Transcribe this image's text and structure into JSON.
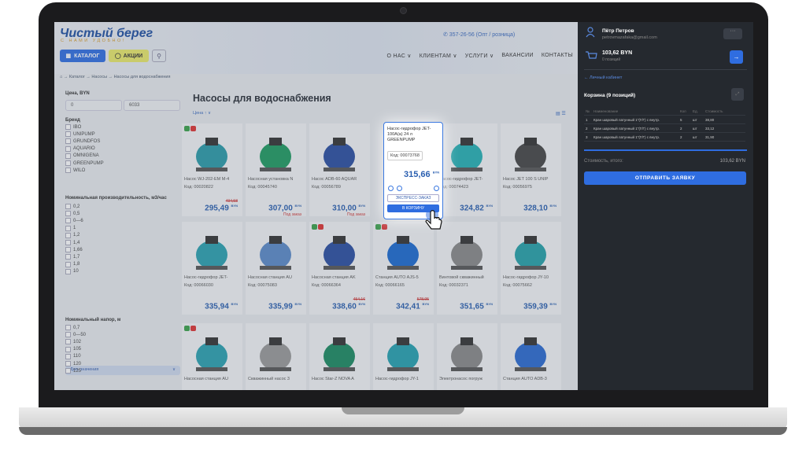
{
  "header": {
    "logo": "Чистый берег",
    "slogan": "С НАМИ УДОБНО!",
    "phone": "✆ 357-26-56 (Опт / розница)",
    "catalog_label": "КАТАЛОГ",
    "promo_label": "АКЦИИ",
    "nav": [
      "О НАС ∨",
      "КЛИЕНТАМ ∨",
      "УСЛУГИ ∨",
      "ВАКАНСИИ",
      "КОНТАКТЫ"
    ]
  },
  "breadcrumb": "⌂ → Каталог → Насосы → Насосы для водоснабжения",
  "filters": {
    "price_label": "Цена, BYN",
    "price_min": "0",
    "price_max": "6033",
    "brand_label": "Бренд",
    "brands": [
      "IBO",
      "UNIPUMP",
      "GRUNDFOS",
      "AQUARIO",
      "OMNIGENA",
      "GREENPUMP",
      "WILO"
    ],
    "perf_label": "Номинальная производительность, м3/час",
    "perf": [
      "0,2",
      "0,5",
      "0—6",
      "1",
      "1,2",
      "1,4",
      "1,66",
      "1,7",
      "1,8",
      "10"
    ],
    "more_label": "Доп. значения",
    "head_label": "Номинальный напор, м",
    "head": [
      "0,7",
      "0—50",
      "102",
      "105",
      "110",
      "120",
      "125"
    ]
  },
  "page_title": "Насосы для водоснабжения",
  "sort_label": "Цена ↑   ∨",
  "products": [
    {
      "name": "Насос WJ-202-EM M-4",
      "code": "Код: 00020822",
      "old": "494,58",
      "price": "295,49",
      "note": "",
      "badges": true
    },
    {
      "name": "Насосная установка N",
      "code": "Код: 00045740",
      "old": "",
      "price": "307,00",
      "note": "Под заказ",
      "badges": false
    },
    {
      "name": "Насос ADB-60 AQUAR",
      "code": "Код: 00056789",
      "old": "",
      "price": "310,00",
      "note": "Под заказ",
      "badges": false
    },
    {
      "name": "Насос-гидрофор JET-",
      "code": "Код: 00074423",
      "old": "",
      "price": "324,82",
      "note": "",
      "badges": false
    },
    {
      "name": "Насос JET 100 S UNIP",
      "code": "Код: 00056975",
      "old": "",
      "price": "328,10",
      "note": "",
      "badges": false
    },
    {
      "name": "Насос-гидрофор JET-",
      "code": "Код: 00066030",
      "old": "",
      "price": "335,94",
      "note": "",
      "badges": false
    },
    {
      "name": "Насосная станция AU",
      "code": "Код: 00075083",
      "old": "",
      "price": "335,99",
      "note": "",
      "badges": false
    },
    {
      "name": "Насосная станция AK",
      "code": "Код: 00066364",
      "old": "454,16",
      "price": "338,60",
      "note": "",
      "badges": true
    },
    {
      "name": "Станция AUTO AJS-5",
      "code": "Код: 00066165",
      "old": "578,95",
      "price": "342,41",
      "note": "",
      "badges": true
    },
    {
      "name": "Винтовой скважинный",
      "code": "Код: 00032371",
      "old": "",
      "price": "351,65",
      "note": "",
      "badges": false
    },
    {
      "name": "Насос-гидрофор JY-10",
      "code": "Код: 00075662",
      "old": "",
      "price": "359,39",
      "note": "",
      "badges": false
    },
    {
      "name": "Насосная станция AU",
      "code": "",
      "old": "",
      "price": "",
      "note": "",
      "badges": true
    },
    {
      "name": "Скважинный насос 3",
      "code": "",
      "old": "",
      "price": "",
      "note": "",
      "badges": false
    },
    {
      "name": "Насос Star-Z NOVA A",
      "code": "",
      "old": "",
      "price": "",
      "note": "",
      "badges": false
    },
    {
      "name": "Насос-гидрофор JY-1",
      "code": "",
      "old": "",
      "price": "",
      "note": "",
      "badges": false
    },
    {
      "name": "Электронасос погруж",
      "code": "",
      "old": "",
      "price": "",
      "note": "",
      "badges": false
    },
    {
      "name": "Станция AUTO ADB-3",
      "code": "",
      "old": "",
      "price": "",
      "note": "",
      "badges": false
    }
  ],
  "currency": "BYN",
  "popup": {
    "name": "Насос-гидрофор JET-100A(a) 24 л GREENPUMP",
    "code": "Код: 00073768",
    "price": "315,66",
    "express": "ЭКСПРЕСС-ЗАКАЗ",
    "cart": "В КОРЗИНУ"
  },
  "sidebar": {
    "user_name": "Пётр Петров",
    "user_email": "petrovmazafaka@gmail.com",
    "dots": "···",
    "balance": "103,62 BYN",
    "positions": "0 позиций",
    "cabinet_link": "←  Личный кабинет",
    "basket_title": "Корзина (9 позиций)",
    "headers": [
      "№",
      "Наименование",
      "Кол",
      "Ед.",
      "Стоимость"
    ],
    "rows": [
      [
        "1",
        "Кран шаровый латунный 1\"(Г/Г) с внутр.",
        "5",
        "шт",
        "38,80"
      ],
      [
        "2",
        "Кран шаровый латунный 1\"(Г/Г) с внутр.",
        "2",
        "шт",
        "33,12"
      ],
      [
        "3",
        "Кран шаровый латунный 1\"(Г/Г) с внутр.",
        "2",
        "шт",
        "31,90"
      ]
    ],
    "total_label": "Стоимость, итого:",
    "total_value": "103,62 BYN",
    "send_label": "ОТПРАВИТЬ ЗАЯВКУ"
  }
}
